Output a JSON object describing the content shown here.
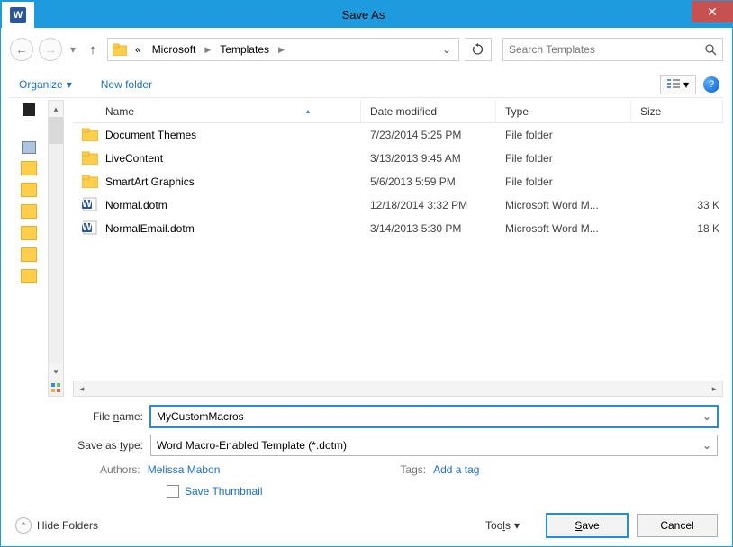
{
  "titlebar": {
    "title": "Save As"
  },
  "nav": {
    "crumb_prefix": "«",
    "crumb1": "Microsoft",
    "crumb2": "Templates"
  },
  "search": {
    "placeholder": "Search Templates"
  },
  "toolbar": {
    "organize": "Organize",
    "new_folder": "New folder"
  },
  "columns": {
    "name": "Name",
    "date": "Date modified",
    "type": "Type",
    "size": "Size"
  },
  "files": [
    {
      "name": "Document Themes",
      "date": "7/23/2014 5:25 PM",
      "type": "File folder",
      "size": "",
      "icon": "folder"
    },
    {
      "name": "LiveContent",
      "date": "3/13/2013 9:45 AM",
      "type": "File folder",
      "size": "",
      "icon": "folder"
    },
    {
      "name": "SmartArt Graphics",
      "date": "5/6/2013 5:59 PM",
      "type": "File folder",
      "size": "",
      "icon": "folder"
    },
    {
      "name": "Normal.dotm",
      "date": "12/18/2014 3:32 PM",
      "type": "Microsoft Word M...",
      "size": "33 K",
      "icon": "word"
    },
    {
      "name": "NormalEmail.dotm",
      "date": "3/14/2013 5:30 PM",
      "type": "Microsoft Word M...",
      "size": "18 K",
      "icon": "word"
    }
  ],
  "form": {
    "filename_label": "File name:",
    "filename_value": "MyCustomMacros",
    "saveastype_label": "Save as type:",
    "saveastype_value": "Word Macro-Enabled Template (*.dotm)",
    "authors_label": "Authors:",
    "authors_value": "Melissa Mabon",
    "tags_label": "Tags:",
    "tags_value": "Add a tag",
    "save_thumbnail": "Save Thumbnail"
  },
  "footer": {
    "hide_folders": "Hide Folders",
    "tools": "Tools",
    "save": "Save",
    "cancel": "Cancel"
  }
}
